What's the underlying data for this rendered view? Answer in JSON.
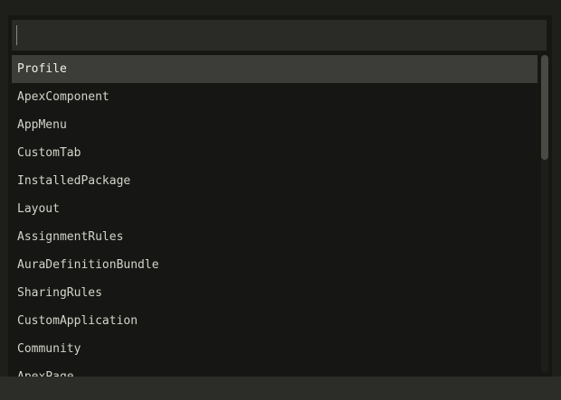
{
  "search": {
    "value": "",
    "placeholder": ""
  },
  "list": {
    "items": [
      {
        "label": "Profile",
        "selected": true
      },
      {
        "label": "ApexComponent"
      },
      {
        "label": "AppMenu"
      },
      {
        "label": "CustomTab"
      },
      {
        "label": "InstalledPackage"
      },
      {
        "label": "Layout"
      },
      {
        "label": "AssignmentRules"
      },
      {
        "label": "AuraDefinitionBundle"
      },
      {
        "label": "SharingRules"
      },
      {
        "label": "CustomApplication"
      },
      {
        "label": "Community"
      },
      {
        "label": "ApexPage"
      }
    ]
  },
  "scroll": {
    "position_fraction": 0.0,
    "visible_fraction": 0.33
  }
}
